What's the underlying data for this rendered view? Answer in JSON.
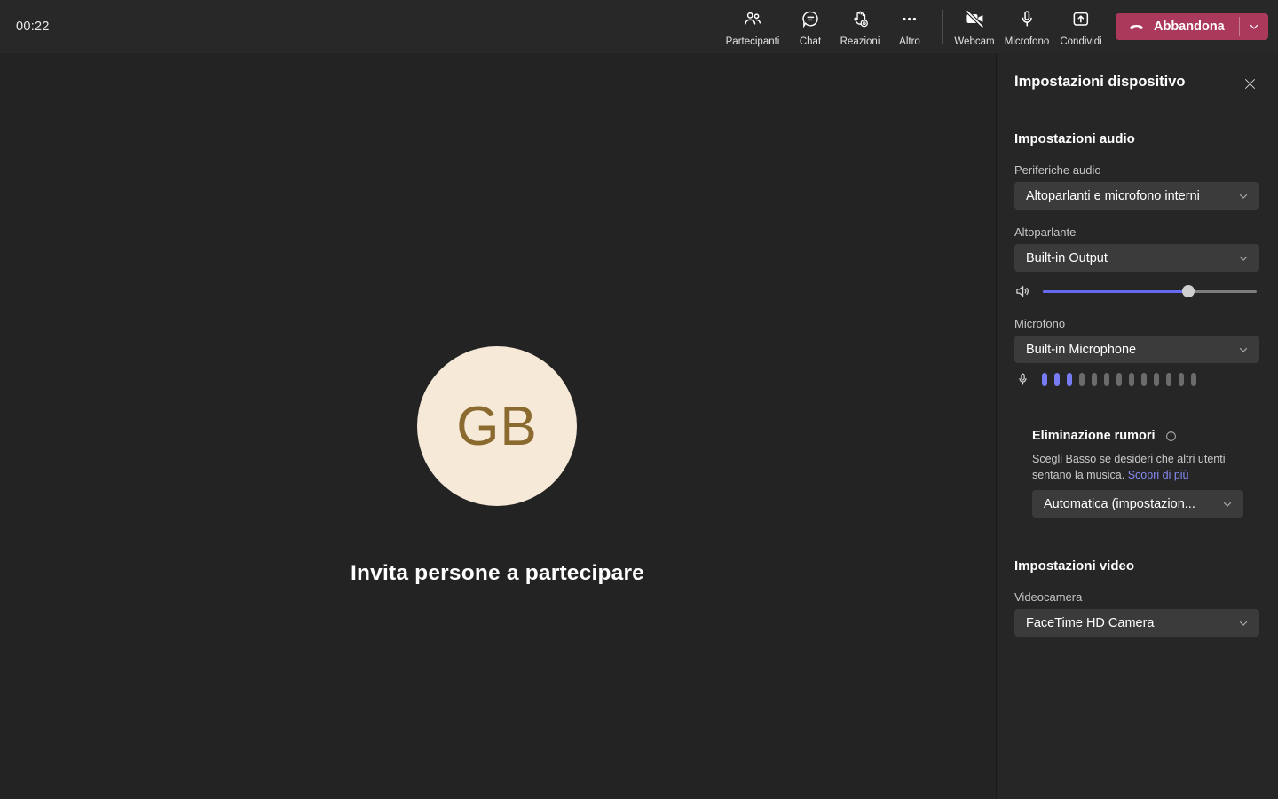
{
  "toolbar": {
    "timer": "00:22",
    "items": [
      {
        "id": "participants",
        "label": "Partecipanti"
      },
      {
        "id": "chat",
        "label": "Chat"
      },
      {
        "id": "reactions",
        "label": "Reazioni"
      },
      {
        "id": "more",
        "label": "Altro"
      }
    ],
    "device_items": [
      {
        "id": "webcam",
        "label": "Webcam",
        "state": "off"
      },
      {
        "id": "microphone",
        "label": "Microfono",
        "state": "on"
      },
      {
        "id": "share",
        "label": "Condividi"
      }
    ],
    "leave_label": "Abbandona"
  },
  "stage": {
    "avatar_initials": "GB",
    "invite_text": "Invita persone a partecipare"
  },
  "panel": {
    "title": "Impostazioni dispositivo",
    "audio": {
      "heading": "Impostazioni audio",
      "devices_label": "Periferiche audio",
      "devices_value": "Altoparlanti e microfono interni",
      "speaker_label": "Altoparlante",
      "speaker_value": "Built-in Output",
      "volume_percent": 68,
      "mic_label": "Microfono",
      "mic_value": "Built-in Microphone",
      "mic_meter": {
        "total_bars": 13,
        "active_bars": 3
      }
    },
    "noise": {
      "heading": "Eliminazione rumori",
      "description": "Scegli Basso se desideri che altri utenti sentano la musica.",
      "link_label": "Scopri di più",
      "value": "Automatica (impostazion..."
    },
    "video": {
      "heading": "Impostazioni video",
      "camera_label": "Videocamera",
      "camera_value": "FaceTime HD Camera"
    }
  },
  "icons": {
    "participants": "two-people-outline",
    "chat": "speech-bubble",
    "reactions": "raised-hand-smiley",
    "more": "three-dots",
    "webcam": "camera-with-slash",
    "microphone": "microphone-outline",
    "share": "square-arrow-up",
    "leave": "hangup-handset",
    "speaker": "speaker-waves",
    "info": "info-circle",
    "close": "x-mark",
    "chevron": "chevron-down"
  },
  "colors": {
    "accent": "#666af0",
    "meter_active": "#777cf2",
    "meter_idle": "#6b6b6b",
    "link": "#868af2",
    "leave_button": "#ab395c",
    "toolbar_bg": "#282828",
    "stage_bg": "#232323",
    "panel_bg": "#262626",
    "field_bg": "#3b3b3b",
    "avatar_bg": "#f6e9d7",
    "avatar_text": "#8a6a2e"
  }
}
